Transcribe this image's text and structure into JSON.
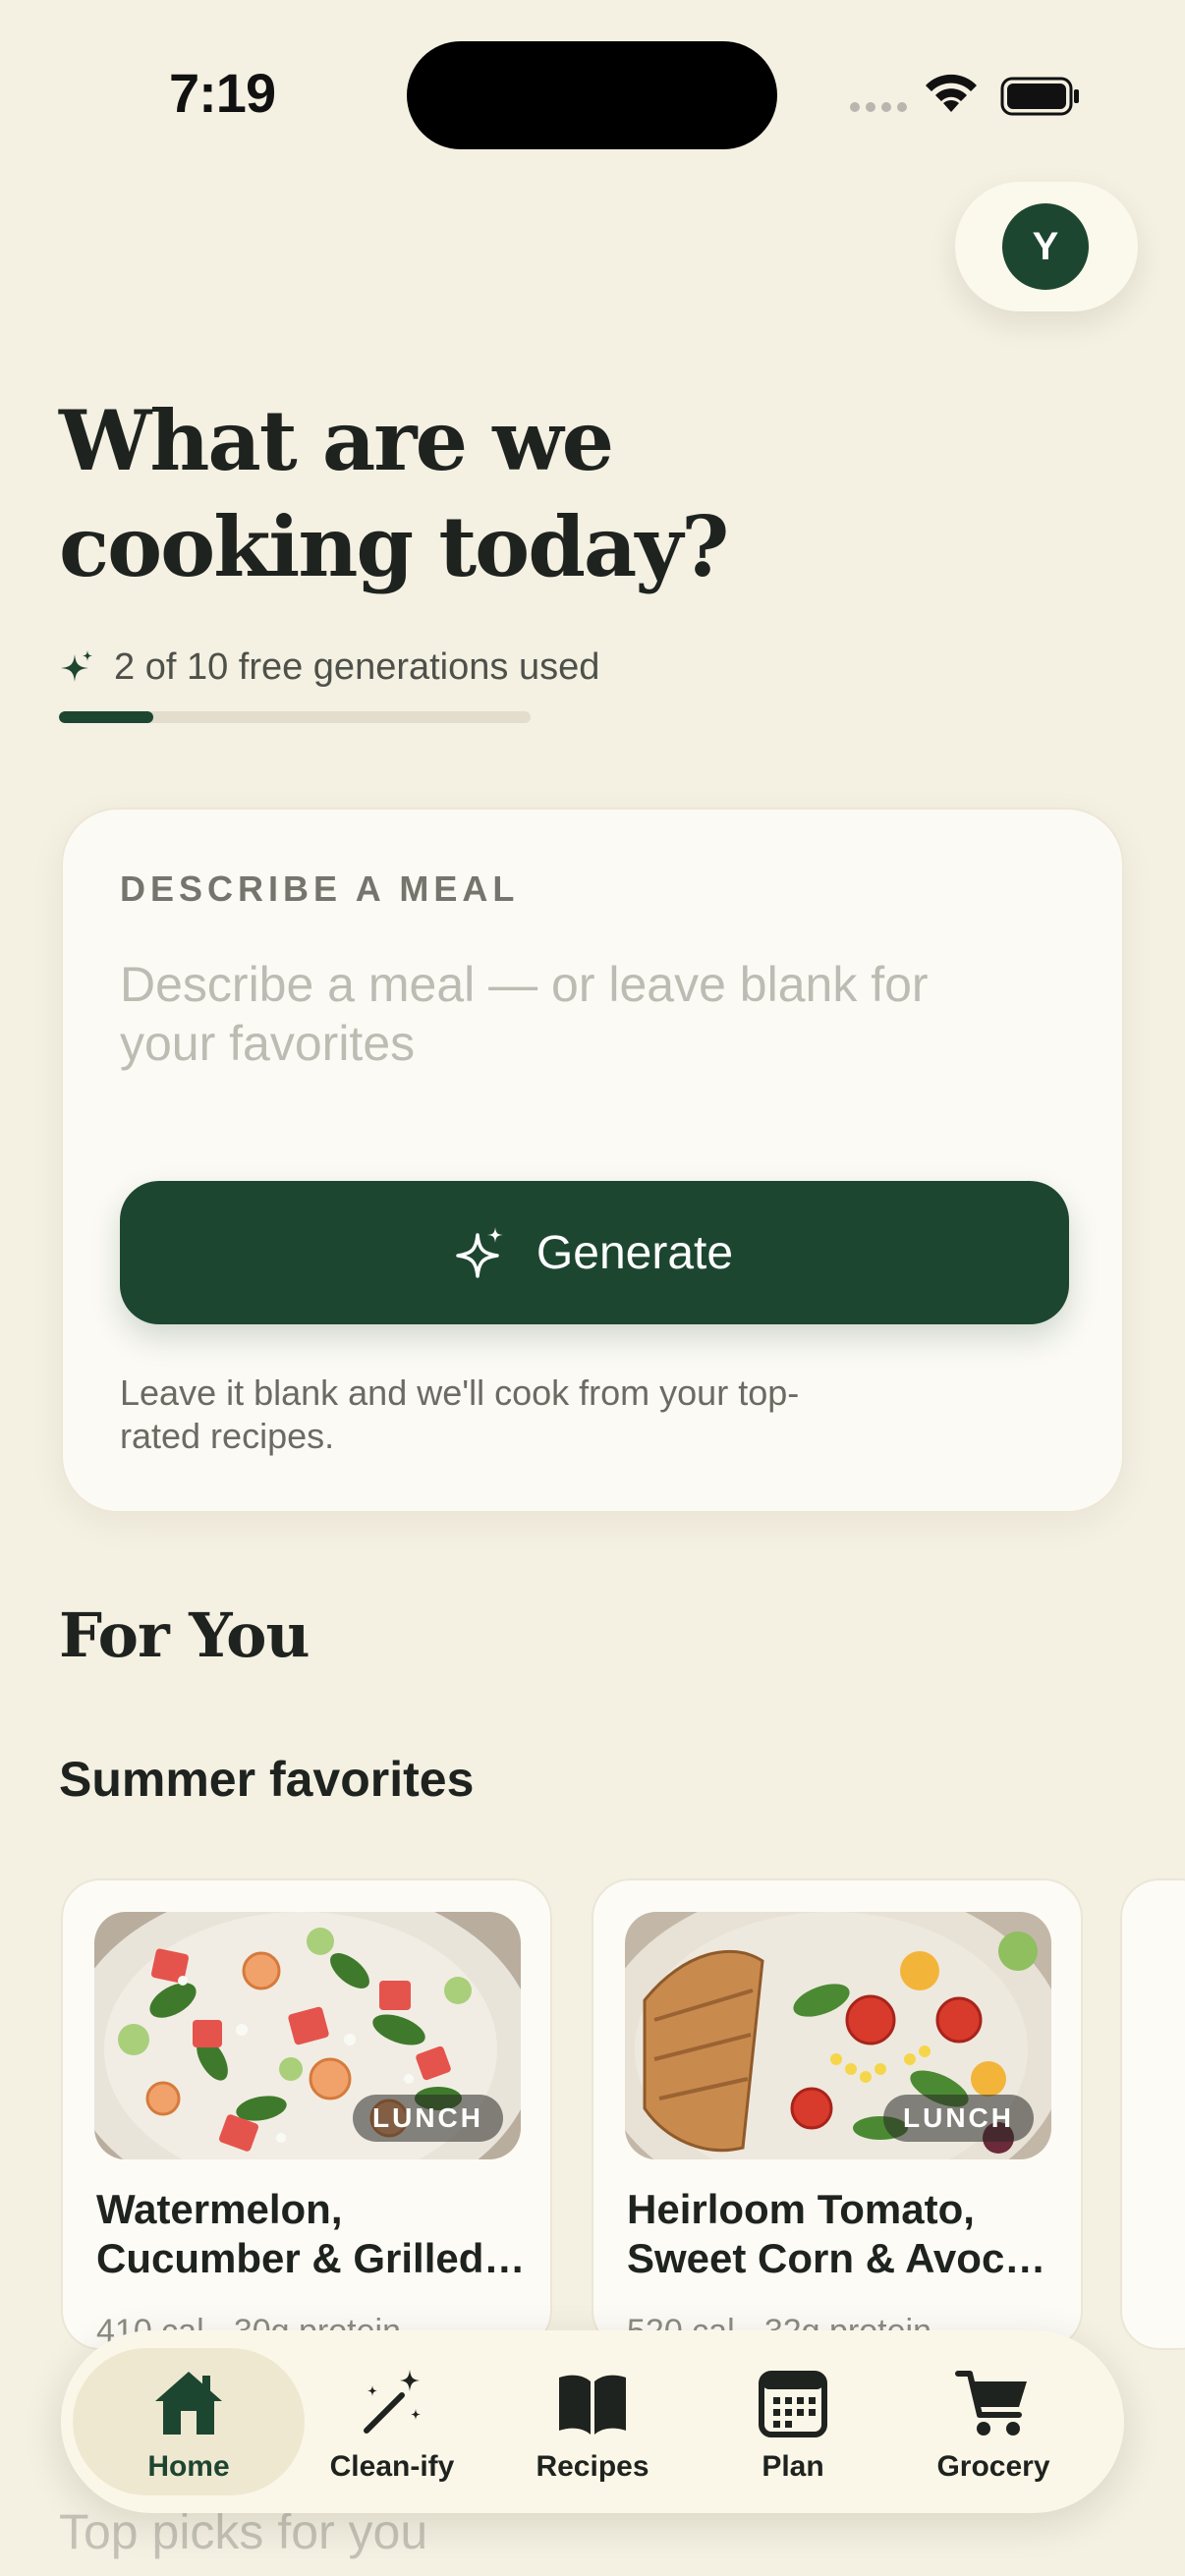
{
  "status_bar": {
    "time": "7:19"
  },
  "profile": {
    "avatar_initial": "Y"
  },
  "header": {
    "headline_line1": "What are we",
    "headline_line2": "cooking today?"
  },
  "usage": {
    "text": "2 of 10 free generations used",
    "used": 2,
    "total": 10,
    "fraction": 0.2
  },
  "meal_card": {
    "label": "DESCRIBE A MEAL",
    "input_value": "",
    "input_placeholder": "Describe a meal — or leave blank for your favorites",
    "generate_label": "Generate",
    "hint": "Leave it blank and we'll cook from your top-rated recipes."
  },
  "for_you": {
    "title": "For You",
    "section_title": "Summer favorites",
    "recipes": [
      {
        "title_line1": "Watermelon,",
        "title_line2": "Cucumber & Grilled…",
        "tag": "LUNCH",
        "meta": "410 cal · 30g protein"
      },
      {
        "title_line1": "Heirloom Tomato,",
        "title_line2": "Sweet Corn & Avoc…",
        "tag": "LUNCH",
        "meta": "520 cal · 32g protein"
      }
    ],
    "next_section_title": "Top picks for you"
  },
  "tabs": [
    {
      "label": "Home",
      "icon": "home-icon",
      "active": true
    },
    {
      "label": "Clean-ify",
      "icon": "magic-wand-icon",
      "active": false
    },
    {
      "label": "Recipes",
      "icon": "book-icon",
      "active": false
    },
    {
      "label": "Plan",
      "icon": "calendar-icon",
      "active": false
    },
    {
      "label": "Grocery",
      "icon": "cart-icon",
      "active": false
    }
  ],
  "colors": {
    "background": "#f4f0e2",
    "accent": "#1d4631",
    "card": "#fbfaf4"
  }
}
